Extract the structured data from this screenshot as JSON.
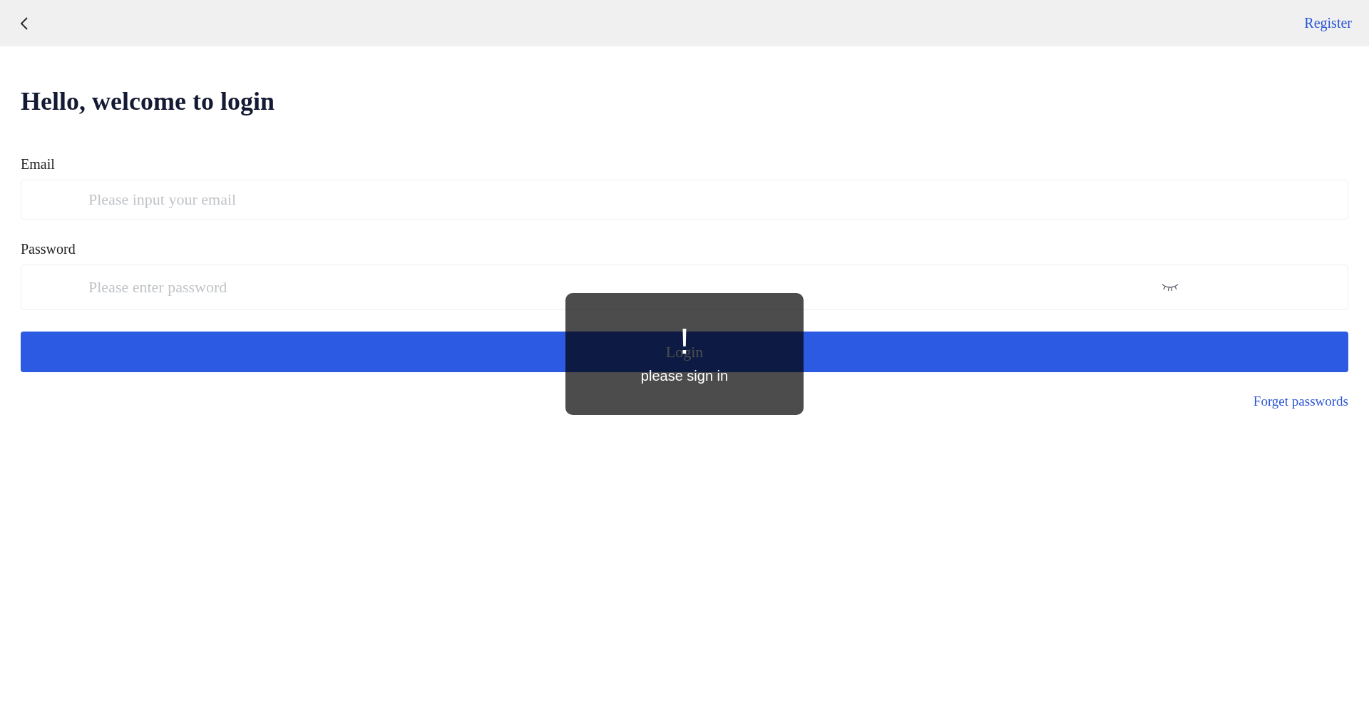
{
  "header": {
    "register_link": "Register"
  },
  "title": "Hello, welcome to login",
  "fields": [
    {
      "label": "Email",
      "placeholder": "Please input your email",
      "kind": "text"
    },
    {
      "label": "Password",
      "placeholder": "Please enter password",
      "kind": "password"
    }
  ],
  "login_button": "Login",
  "forgot_link": "Forget passwords",
  "toast": {
    "icon": "!",
    "message": "please sign in"
  }
}
